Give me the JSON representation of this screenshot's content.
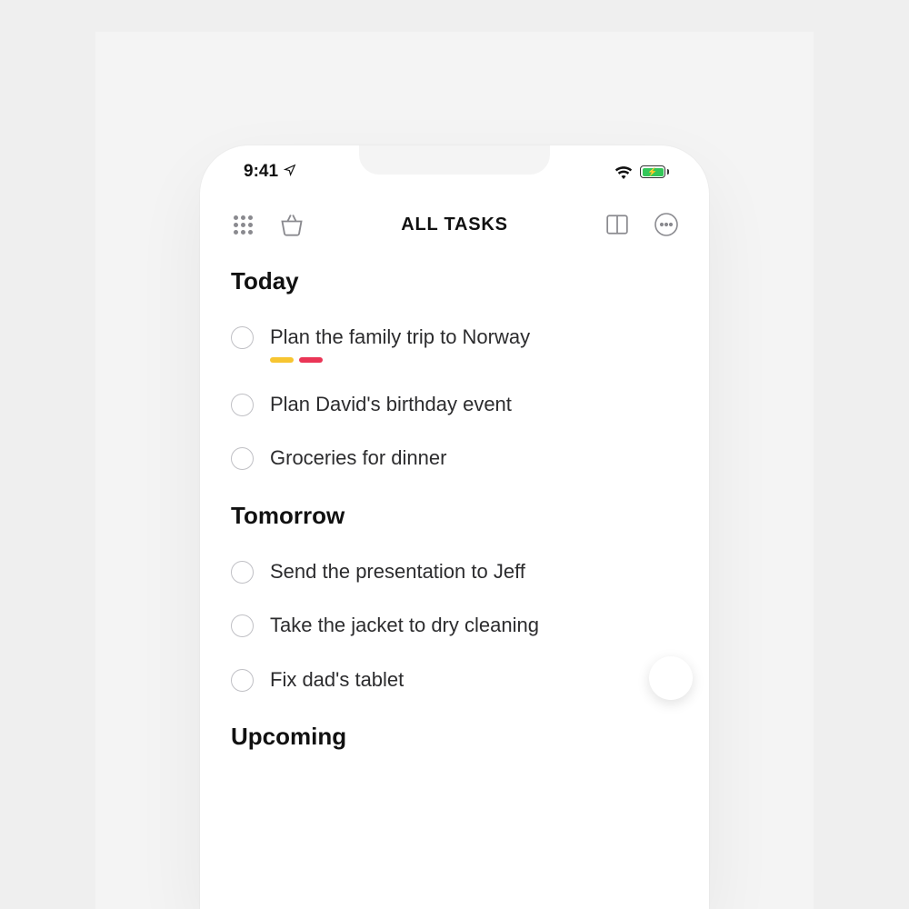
{
  "status": {
    "time": "9:41",
    "location_icon": "location-arrow-icon",
    "wifi_icon": "wifi-icon",
    "battery_icon": "battery-charging-icon"
  },
  "nav": {
    "grid_icon": "grid-icon",
    "basket_icon": "basket-icon",
    "title": "ALL TASKS",
    "columns_icon": "columns-icon",
    "more_icon": "more-icon"
  },
  "sections": [
    {
      "title": "Today",
      "tasks": [
        {
          "label": "Plan the family trip to Norway",
          "tags": [
            "yellow",
            "red"
          ]
        },
        {
          "label": "Plan David's birthday event",
          "tags": []
        },
        {
          "label": "Groceries for dinner",
          "tags": []
        }
      ]
    },
    {
      "title": "Tomorrow",
      "tasks": [
        {
          "label": "Send the presentation to Jeff",
          "tags": []
        },
        {
          "label": "Take the jacket to dry cleaning",
          "tags": []
        },
        {
          "label": "Fix dad's tablet",
          "tags": []
        }
      ]
    },
    {
      "title": "Upcoming",
      "tasks": []
    }
  ],
  "colors": {
    "tag_yellow": "#f7c531",
    "tag_red": "#ea3556",
    "battery_green": "#34c759"
  }
}
